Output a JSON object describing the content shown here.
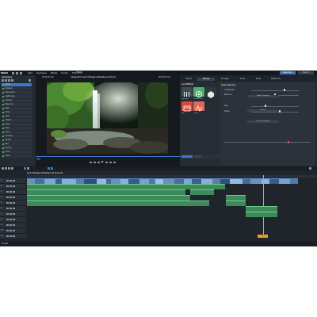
{
  "app": {
    "logo": "MAGIX",
    "menu": [
      "Datei",
      "Bearbeiten",
      "Effekte",
      "Fenster",
      "Hilfe"
    ],
    "badge": "Store",
    "right_buttons": [
      "Speichern",
      "Export"
    ]
  },
  "left_panel": {
    "title": "Übergänge",
    "items": [
      "Alpha",
      "Dissolve",
      "Fade in/out",
      "Light leaks",
      "Overlay",
      "Page turn",
      "Push",
      "Slide",
      "Split",
      "Stretch",
      "Swap",
      "Wipe",
      "Zoom",
      "3D Cube",
      "3D Flip",
      "Blur",
      "Bounce",
      "Circle",
      "Cross"
    ]
  },
  "preview": {
    "title": "Programm: Sound Design Ambiente und Sound",
    "time_left": "00:00:01:16",
    "time_right": "00:00:03:14",
    "range_label": "Ausschnitt"
  },
  "right_panel": {
    "tabs": [
      "Import",
      "Effekte",
      "Vorlagen",
      "Audio",
      "Store",
      "MAGIX Go"
    ],
    "active_tab": 1,
    "section_title": "AudioEffekte",
    "tile_labels": [
      "Equalizer",
      "Kompressor",
      "Hall",
      "Delay"
    ],
    "sub_section": "Audio-Cleaning",
    "params": [
      {
        "label": "Lautstärke",
        "value": 0.7
      },
      {
        "label": "Balance",
        "value": 0.5
      },
      {
        "label": "Hall",
        "value": 0.3
      },
      {
        "label": "Delay",
        "value": 0.6
      }
    ],
    "buttons": [
      "Audio Cleaning",
      "Mixer",
      "Frequenzanalyse"
    ],
    "tile_colors": {
      "eq": "#4fae6a",
      "comp": "#ffffff",
      "fx1": "#d94a3a",
      "fx2": "#e06a5a"
    }
  },
  "timeline": {
    "title": "Sound Design Ambiente und Sound ▼",
    "tracks": [
      "1",
      "2",
      "3",
      "4",
      "5",
      "6",
      "7",
      "8",
      "9",
      "10",
      "11"
    ],
    "marker_label": "Text",
    "status": "Projekt"
  },
  "colors": {
    "accent": "#3d77c9",
    "audio": "#3c8a5a",
    "video": "#4a7fc0",
    "marker": "#f0a020"
  }
}
